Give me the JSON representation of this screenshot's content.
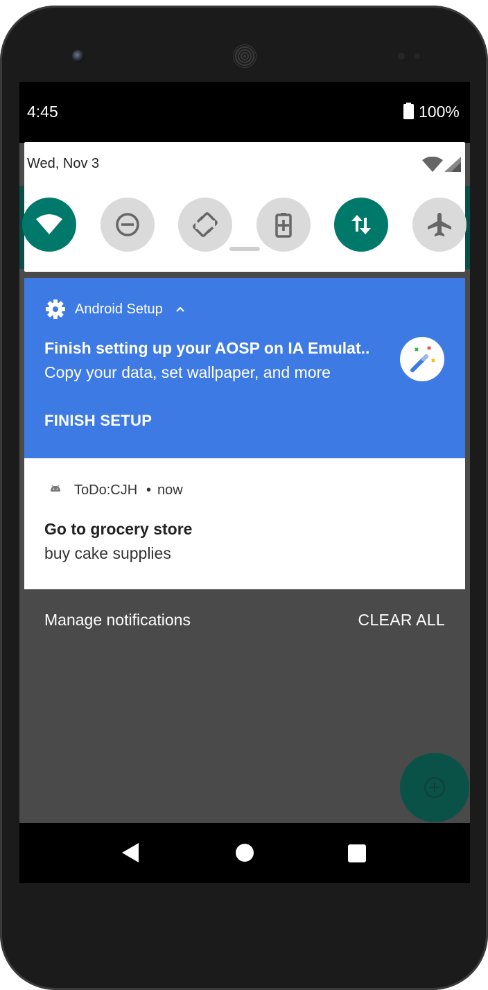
{
  "status_bar": {
    "time": "4:45",
    "battery_percent": "100%",
    "battery_icon": "battery-full-icon"
  },
  "quick_settings": {
    "date": "Wed, Nov 3",
    "status_icons": [
      "wifi-icon",
      "cellular-signal-icon"
    ],
    "tiles": [
      {
        "name": "wifi",
        "icon": "wifi-icon",
        "active": true
      },
      {
        "name": "do-not-disturb",
        "icon": "do-not-disturb-icon",
        "active": false
      },
      {
        "name": "auto-rotate",
        "icon": "auto-rotate-icon",
        "active": false
      },
      {
        "name": "battery-saver",
        "icon": "battery-saver-icon",
        "active": false
      },
      {
        "name": "mobile-data",
        "icon": "data-transfer-icon",
        "active": true
      },
      {
        "name": "airplane-mode",
        "icon": "airplane-icon",
        "active": false
      }
    ]
  },
  "notifications": {
    "setup": {
      "app_name": "Android Setup",
      "title": "Finish setting up your AOSP on IA Emulat..",
      "text": "Copy your data, set wallpaper, and more",
      "action": "FINISH SETUP",
      "icon": "magic-wand-icon",
      "background_color": "#3d7ae4"
    },
    "todo": {
      "app_name": "ToDo:CJH",
      "separator": "•",
      "time": "now",
      "title": "Go to grocery store",
      "text": "buy cake supplies"
    }
  },
  "footer": {
    "manage_label": "Manage notifications",
    "clear_label": "CLEAR ALL"
  },
  "colors": {
    "accent_teal": "#00796b",
    "notification_blue": "#3d7ae4",
    "shade_background": "#4a4a4a"
  },
  "nav_bar": {
    "icons": [
      "back-icon",
      "home-icon",
      "recents-icon"
    ]
  }
}
